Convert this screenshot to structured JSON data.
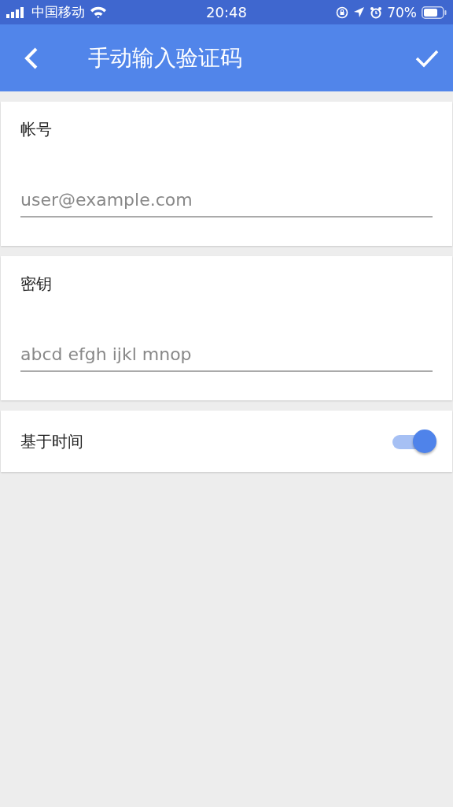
{
  "status_bar": {
    "carrier": "中国移动",
    "time": "20:48",
    "battery": "70%"
  },
  "app_bar": {
    "title": "手动输入验证码"
  },
  "fields": [
    {
      "label": "帐号",
      "placeholder": "user@example.com"
    },
    {
      "label": "密钥",
      "placeholder": "abcd efgh ijkl mnop"
    }
  ],
  "toggle": {
    "label": "基于时间",
    "on": true
  }
}
